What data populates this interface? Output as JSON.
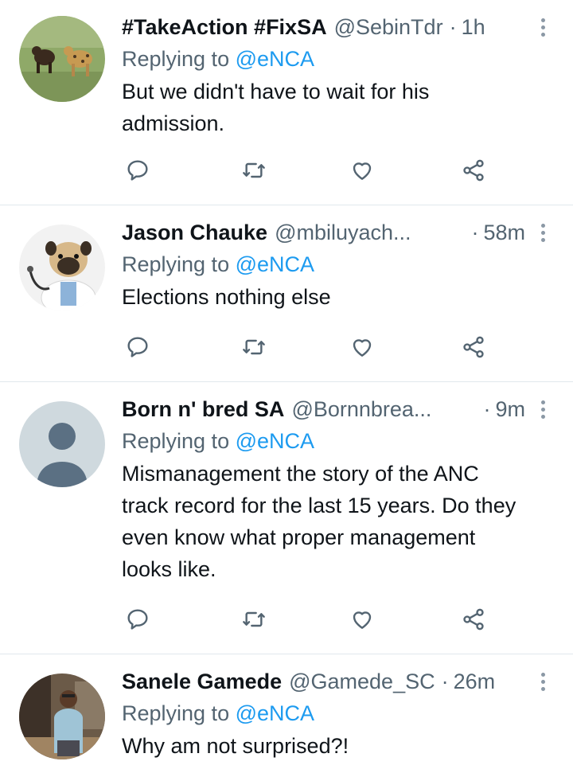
{
  "tweets": [
    {
      "name": "#TakeAction #FixSA",
      "handle": "@SebinTdr",
      "separator": "·",
      "time": "1h",
      "replying_prefix": "Replying to",
      "replying_to": "@eNCA",
      "text": "But we didn't have to wait for his admission.",
      "avatar_icon": "animals-photo-avatar"
    },
    {
      "name": "Jason Chauke",
      "handle": "@mbiluyach...",
      "separator": "·",
      "time": "58m",
      "replying_prefix": "Replying to",
      "replying_to": "@eNCA",
      "text": "Elections nothing else",
      "avatar_icon": "pug-doctor-avatar"
    },
    {
      "name": "Born n' bred SA",
      "handle": "@Bornnbrea...",
      "separator": "·",
      "time": "9m",
      "replying_prefix": "Replying to",
      "replying_to": "@eNCA",
      "text": "Mismanagement the story of the ANC track record for the last 15 years. Do they even know what proper management looks like.",
      "avatar_icon": "default-profile-avatar"
    },
    {
      "name": "Sanele Gamede",
      "handle": "@Gamede_SC",
      "separator": "·",
      "time": "26m",
      "replying_prefix": "Replying to",
      "replying_to": "@eNCA",
      "text": "Why am not surprised?!",
      "avatar_icon": "person-photo-avatar"
    }
  ],
  "icons": {
    "reply": "reply-icon",
    "retweet": "retweet-icon",
    "like": "heart-icon",
    "share": "share-icon",
    "more": "more-vertical-icon"
  },
  "colors": {
    "text": "#0f1419",
    "secondary": "#536471",
    "mention": "#1d9bf0",
    "divider": "#e1e8ed",
    "icon": "#536471"
  }
}
